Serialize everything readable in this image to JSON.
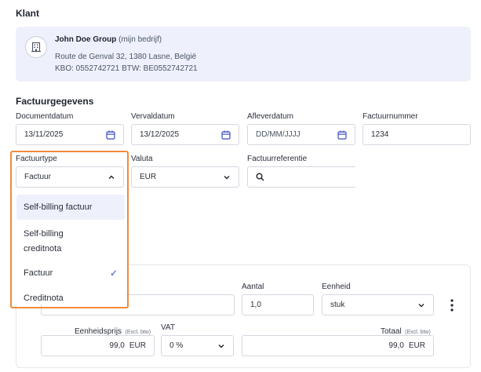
{
  "client": {
    "section_title": "Klant",
    "name": "John Doe Group",
    "tag": "(mijn bedrijf)",
    "address": "Route de Genval 32, 1380 Lasne, België",
    "ids": "KBO: 0552742721 BTW: BE0552742721",
    "icon": "building-icon"
  },
  "invoice": {
    "section_title": "Factuurgegevens",
    "document_date": {
      "label": "Documentdatum",
      "value": "13/11/2025"
    },
    "due_date": {
      "label": "Vervaldatum",
      "value": "13/12/2025"
    },
    "delivery_date": {
      "label": "Afleverdatum",
      "placeholder": "DD/MM/JJJJ"
    },
    "invoice_number": {
      "label": "Factuurnummer",
      "value": "1234"
    },
    "invoice_type": {
      "label": "Factuurtype",
      "value": "Factuur"
    },
    "currency": {
      "label": "Valuta",
      "value": "EUR"
    },
    "reference": {
      "label": "Factuurreferentie",
      "value": ""
    }
  },
  "invoice_type_menu": {
    "items": [
      {
        "label": "Self-billing factuur"
      },
      {
        "label": "Self-billing creditnota"
      },
      {
        "label": "Factuur",
        "checked": "✓"
      },
      {
        "label": "Creditnota"
      }
    ]
  },
  "line_item": {
    "quantity_label": "Aantal",
    "quantity_value": "1,0",
    "unit_label": "Eenheid",
    "unit_value": "stuk",
    "unit_price_label": "Eenheidsprijs",
    "excl_vat": "(Excl. btw)",
    "unit_price_value": "99,0",
    "currency": "EUR",
    "vat_label": "VAT",
    "vat_value": "0 %",
    "total_label": "Totaal",
    "total_value": "99,0"
  },
  "colors": {
    "highlight": "#f28a3b",
    "accent": "#3b4cc0",
    "card_bg": "#eef1fb"
  }
}
